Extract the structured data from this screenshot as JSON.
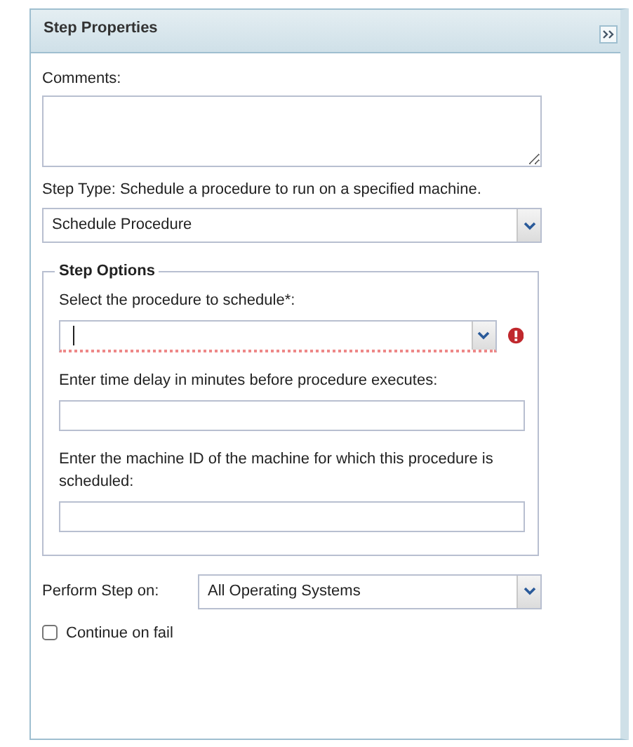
{
  "panel": {
    "title": "Step Properties"
  },
  "comments": {
    "label": "Comments:"
  },
  "step_type": {
    "label": "Step Type: Schedule a procedure to run on a specified machine.",
    "value": "Schedule Procedure"
  },
  "step_options": {
    "legend": "Step Options",
    "fields": [
      {
        "kind": "combo",
        "label": "Select the procedure to schedule*:",
        "invalid": true
      },
      {
        "kind": "text",
        "label": "Enter time delay in minutes before procedure executes:"
      },
      {
        "kind": "text",
        "label": "Enter the machine ID of the machine for which this procedure is scheduled:"
      }
    ]
  },
  "perform_on": {
    "label": "Perform Step on:",
    "value": "All Operating Systems"
  },
  "continue_on_fail": {
    "label": "Continue on fail",
    "checked": false
  }
}
